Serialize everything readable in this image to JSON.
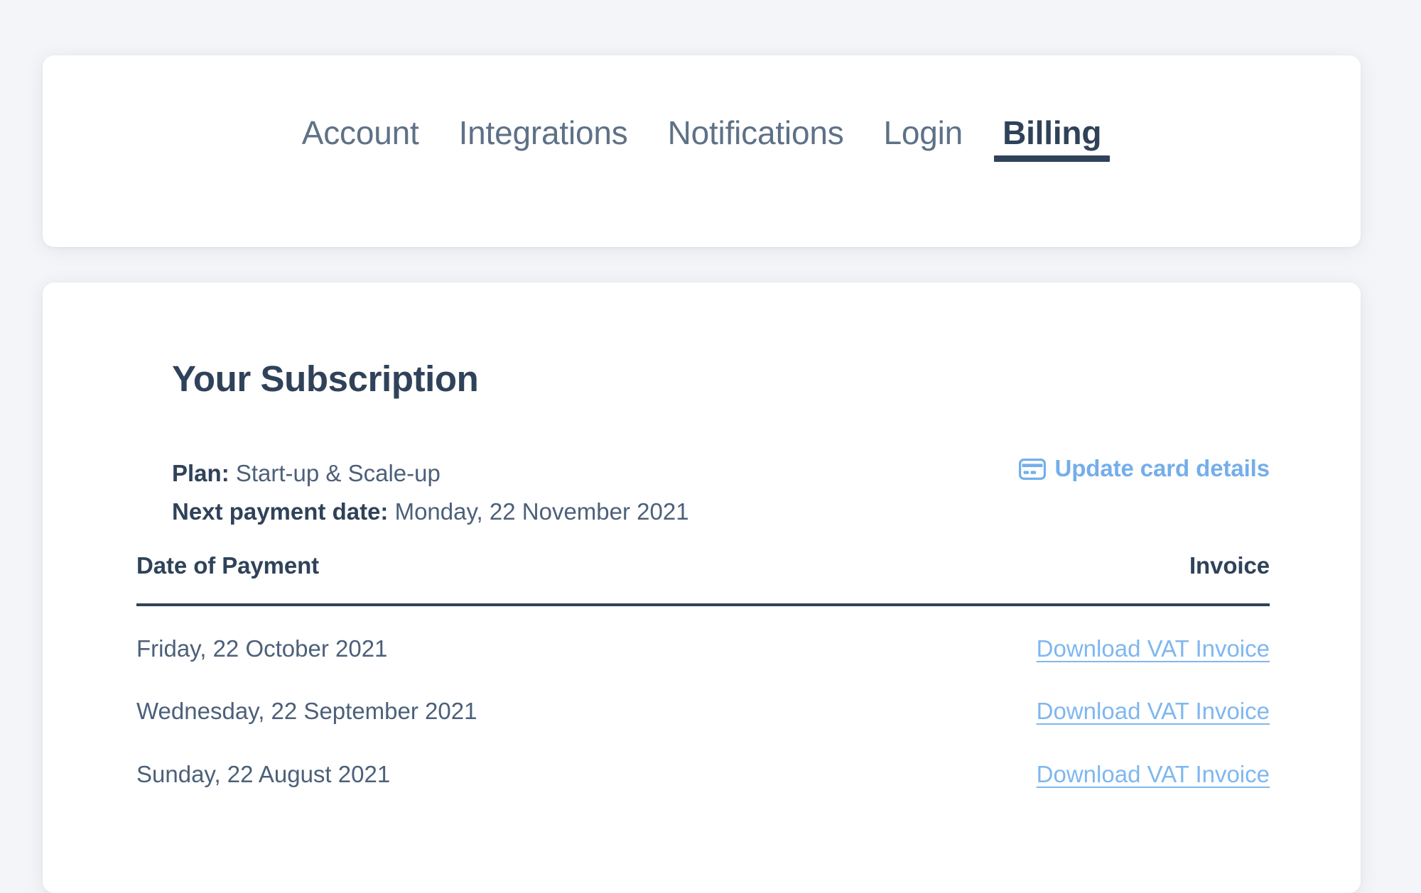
{
  "theme": {
    "page_background": "#f4f5f8",
    "card_background": "#ffffff",
    "text_dark": "#2f4259",
    "text_body": "#4c6079",
    "tab_inactive": "#5e7187",
    "link_blue": "#74aeeb",
    "invoice_link_blue": "#7fb7ef"
  },
  "tabs": {
    "items": [
      {
        "label": "Account",
        "active": false
      },
      {
        "label": "Integrations",
        "active": false
      },
      {
        "label": "Notifications",
        "active": false
      },
      {
        "label": "Login",
        "active": false
      },
      {
        "label": "Billing",
        "active": true
      }
    ]
  },
  "subscription": {
    "title": "Your Subscription",
    "plan_label": "Plan:",
    "plan_value": "Start-up & Scale-up",
    "next_payment_label": "Next payment date:",
    "next_payment_value": "Monday, 22 November 2021",
    "update_card_link": "Update card details",
    "update_card_icon": "credit-card-icon"
  },
  "payments_table": {
    "columns": [
      "Date of Payment",
      "Invoice"
    ],
    "rows": [
      {
        "date": "Friday, 22 October 2021",
        "invoice": "Download VAT Invoice"
      },
      {
        "date": "Wednesday, 22 September 2021",
        "invoice": "Download VAT Invoice"
      },
      {
        "date": "Sunday, 22 August 2021",
        "invoice": "Download VAT Invoice"
      }
    ]
  }
}
